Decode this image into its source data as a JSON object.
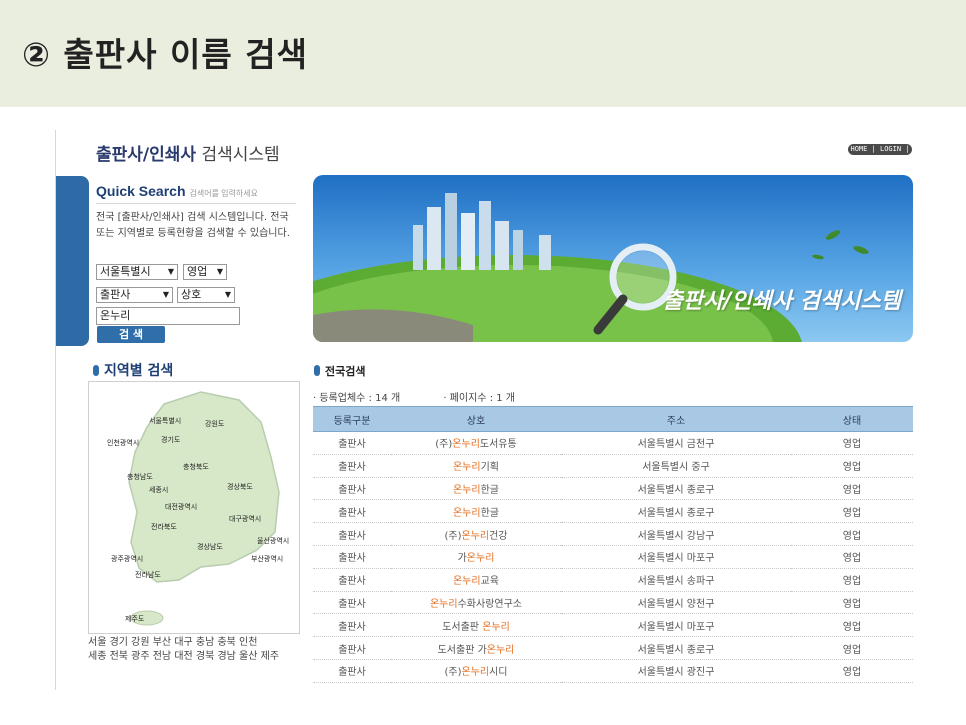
{
  "slide_title": "② 출판사 이름 검색",
  "site": {
    "title_main": "출판사/인쇄사",
    "title_sub": " 검색시스템",
    "home_login": "HOME | LOGIN |"
  },
  "quick_search": {
    "title": "Quick Search",
    "hint": "검색어를 입력하세요",
    "description": "전국 [출판사/인쇄사] 검색 시스템입니다. 전국 또는 지역별로 등록현황을 검색할 수 있습니다.",
    "region_select": "서울특별시",
    "status_select": "영업",
    "type_select": "출판사",
    "field_select": "상호",
    "keyword": "온누리",
    "search_button": "검 색"
  },
  "banner_text": "출판사/인쇄사 검색시스템",
  "region": {
    "title": "지역별 검색",
    "map_labels": [
      "서울특별시",
      "강원도",
      "인천광역시",
      "경기도",
      "충청북도",
      "충청남도",
      "세종시",
      "경상북도",
      "대전광역시",
      "대구광역시",
      "전라북도",
      "경상남도",
      "울산광역시",
      "광주광역시",
      "부산광역시",
      "전라남도",
      "제주도"
    ],
    "links_line1": "서울 경기 강원 부산 대구 충남 충북 인천",
    "links_line2": "세종 전북 광주 전남 대전 경북 경남 울산 제주"
  },
  "results": {
    "title": "전국검색",
    "count_label": "· 등록업체수 : 14 개",
    "page_label": "· 페이지수 : 1 개",
    "columns": [
      "등록구분",
      "상호",
      "주소",
      "상태"
    ],
    "rows": [
      {
        "type": "출판사",
        "pre": "(주)",
        "hit": "온누리",
        "post": "도서유통",
        "addr": "서울특별시 금천구",
        "status": "영업"
      },
      {
        "type": "출판사",
        "pre": "",
        "hit": "온누리",
        "post": "기획",
        "addr": "서울특별시 중구",
        "status": "영업"
      },
      {
        "type": "출판사",
        "pre": "",
        "hit": "온누리",
        "post": "한글",
        "addr": "서울특별시 종로구",
        "status": "영업"
      },
      {
        "type": "출판사",
        "pre": "",
        "hit": "온누리",
        "post": "한글",
        "addr": "서울특별시 종로구",
        "status": "영업"
      },
      {
        "type": "출판사",
        "pre": "(주)",
        "hit": "온누리",
        "post": "건강",
        "addr": "서울특별시 강남구",
        "status": "영업"
      },
      {
        "type": "출판사",
        "pre": "가",
        "hit": "온누리",
        "post": "",
        "addr": "서울특별시 마포구",
        "status": "영업"
      },
      {
        "type": "출판사",
        "pre": "",
        "hit": "온누리",
        "post": "교육",
        "addr": "서울특별시 송파구",
        "status": "영업"
      },
      {
        "type": "출판사",
        "pre": "",
        "hit": "온누리",
        "post": "수화사랑연구소",
        "addr": "서울특별시 양천구",
        "status": "영업"
      },
      {
        "type": "출판사",
        "pre": "도서출판 ",
        "hit": "온누리",
        "post": "",
        "addr": "서울특별시 마포구",
        "status": "영업"
      },
      {
        "type": "출판사",
        "pre": "도서출판 가",
        "hit": "온누리",
        "post": "",
        "addr": "서울특별시 종로구",
        "status": "영업"
      },
      {
        "type": "출판사",
        "pre": "(주)",
        "hit": "온누리",
        "post": "시디",
        "addr": "서울특별시 광진구",
        "status": "영업"
      }
    ]
  }
}
